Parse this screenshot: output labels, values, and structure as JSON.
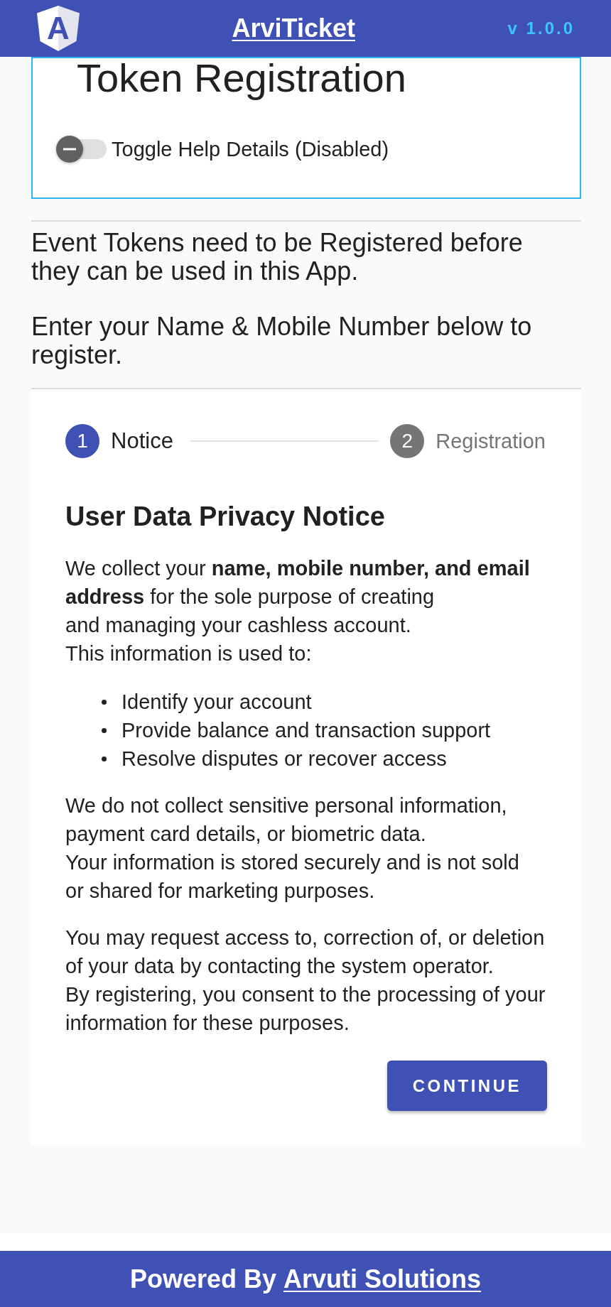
{
  "header": {
    "logo_letter": "A",
    "title": "ArviTicket",
    "version": "v 1.0.0"
  },
  "registration_card": {
    "title": "Token Registration",
    "toggle": {
      "label": "Toggle Help Details (Disabled)",
      "checked": false
    }
  },
  "intro": [
    "Event Tokens need to be Registered before they can be used in this App.",
    "Enter your Name & Mobile Number below to register."
  ],
  "stepper": {
    "steps": [
      {
        "number": "1",
        "label": "Notice",
        "selected": true
      },
      {
        "number": "2",
        "label": "Registration",
        "selected": false
      }
    ]
  },
  "notice": {
    "title": "User Data Privacy Notice",
    "blocks": [
      {
        "kind": "paragraph",
        "text": "We collect your **name, mobile number, and email address** for the sole purpose of creating\nand managing your cashless account.\nThis information is used to:"
      },
      {
        "kind": "list",
        "items": [
          "Identify your account",
          "Provide balance and transaction support",
          "Resolve disputes or recover access"
        ]
      },
      {
        "kind": "paragraph",
        "text": "We do not collect sensitive personal information,\npayment card details, or biometric data.\nYour information is stored securely and is not sold\nor shared for marketing purposes."
      },
      {
        "kind": "paragraph",
        "text": "You may request access to, correction of, or deletion\nof your data by contacting the system operator.\nBy registering, you consent to the processing of your\ninformation for these purposes."
      }
    ],
    "button": "CONTINUE"
  },
  "footer": {
    "prefix": "Powered By",
    "link": "Arvuti Solutions"
  }
}
